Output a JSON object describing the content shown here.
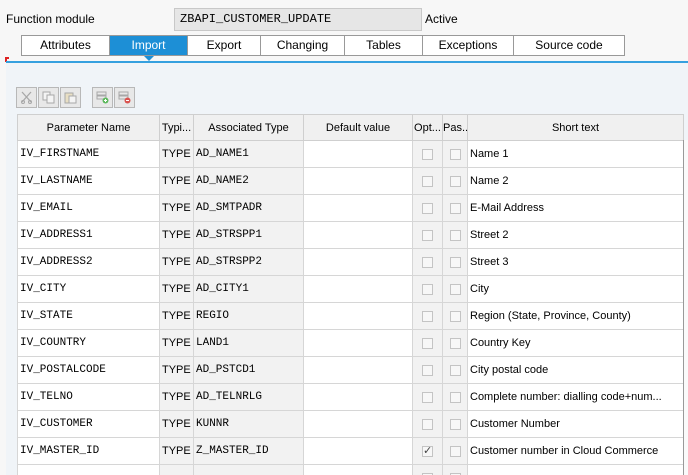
{
  "header": {
    "label": "Function module",
    "module_name": "ZBAPI_CUSTOMER_UPDATE",
    "status": "Active"
  },
  "tabs": [
    {
      "label": "Attributes",
      "active": false
    },
    {
      "label": "Import",
      "active": true
    },
    {
      "label": "Export",
      "active": false
    },
    {
      "label": "Changing",
      "active": false
    },
    {
      "label": "Tables",
      "active": false
    },
    {
      "label": "Exceptions",
      "active": false
    },
    {
      "label": "Source code",
      "active": false
    }
  ],
  "toolbar": {
    "buttons": [
      "cut-icon",
      "copy-icon",
      "paste-icon",
      "insert-row-icon",
      "delete-row-icon"
    ]
  },
  "table": {
    "headers": {
      "param": "Parameter Name",
      "typing": "Typi...",
      "assoc": "Associated Type",
      "default": "Default value",
      "opt": "Opt...",
      "pass": "Pas...",
      "short": "Short text"
    },
    "rows": [
      {
        "param": "IV_FIRSTNAME",
        "typing": "TYPE",
        "assoc": "AD_NAME1",
        "default": "",
        "optional": false,
        "pass_value": false,
        "short": "Name 1"
      },
      {
        "param": "IV_LASTNAME",
        "typing": "TYPE",
        "assoc": "AD_NAME2",
        "default": "",
        "optional": false,
        "pass_value": false,
        "short": "Name 2"
      },
      {
        "param": "IV_EMAIL",
        "typing": "TYPE",
        "assoc": "AD_SMTPADR",
        "default": "",
        "optional": false,
        "pass_value": false,
        "short": "E-Mail Address"
      },
      {
        "param": "IV_ADDRESS1",
        "typing": "TYPE",
        "assoc": "AD_STRSPP1",
        "default": "",
        "optional": false,
        "pass_value": false,
        "short": "Street 2"
      },
      {
        "param": "IV_ADDRESS2",
        "typing": "TYPE",
        "assoc": "AD_STRSPP2",
        "default": "",
        "optional": false,
        "pass_value": false,
        "short": "Street 3"
      },
      {
        "param": "IV_CITY",
        "typing": "TYPE",
        "assoc": "AD_CITY1",
        "default": "",
        "optional": false,
        "pass_value": false,
        "short": "City"
      },
      {
        "param": "IV_STATE",
        "typing": "TYPE",
        "assoc": "REGIO",
        "default": "",
        "optional": false,
        "pass_value": false,
        "short": "Region (State, Province, County)"
      },
      {
        "param": "IV_COUNTRY",
        "typing": "TYPE",
        "assoc": "LAND1",
        "default": "",
        "optional": false,
        "pass_value": false,
        "short": "Country Key"
      },
      {
        "param": "IV_POSTALCODE",
        "typing": "TYPE",
        "assoc": "AD_PSTCD1",
        "default": "",
        "optional": false,
        "pass_value": false,
        "short": "City postal code"
      },
      {
        "param": "IV_TELNO",
        "typing": "TYPE",
        "assoc": "AD_TELNRLG",
        "default": "",
        "optional": false,
        "pass_value": false,
        "short": "Complete number: dialling code+num..."
      },
      {
        "param": "IV_CUSTOMER",
        "typing": "TYPE",
        "assoc": "KUNNR",
        "default": "",
        "optional": false,
        "pass_value": false,
        "short": "Customer Number"
      },
      {
        "param": "IV_MASTER_ID",
        "typing": "TYPE",
        "assoc": "Z_MASTER_ID",
        "default": "",
        "optional": true,
        "pass_value": false,
        "short": "Customer number in Cloud Commerce"
      },
      {
        "param": "",
        "typing": "",
        "assoc": "",
        "default": "",
        "optional": false,
        "pass_value": false,
        "short": ""
      }
    ]
  }
}
